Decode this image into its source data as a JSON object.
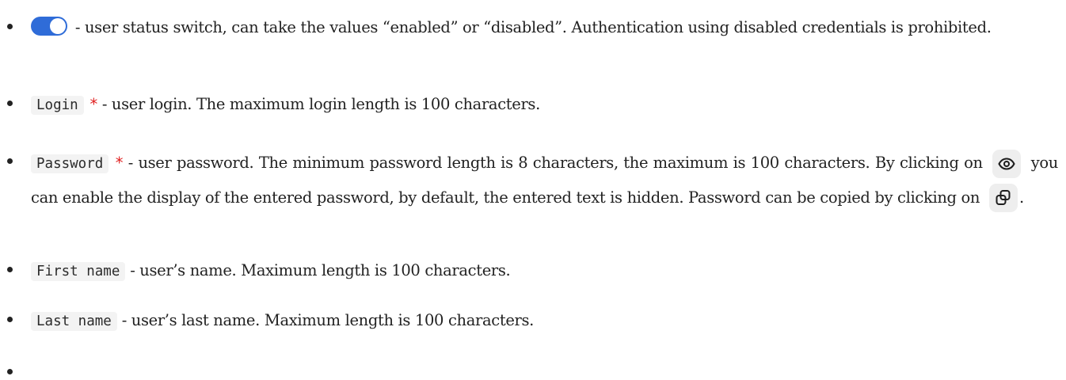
{
  "items": [
    {
      "icon": "toggle-switch-on",
      "description": "- user status switch, can take the values “enabled” or “disabled”. Authentication using disabled credentials is prohibited."
    },
    {
      "field": "Login",
      "required_mark": "*",
      "description": "- user login. The maximum login length is 100 characters."
    },
    {
      "field": "Password",
      "required_mark": "*",
      "description_part1": "- user password. The minimum password length is 8 characters, the maximum is 100 characters. By clicking on",
      "show_icon": "eye-icon",
      "description_part2": "you can enable the display of the entered password, by default, the entered text is hidden. Password can be copied by clicking on",
      "copy_icon": "copy-icon",
      "description_part3": "."
    },
    {
      "field": "First name",
      "description": "- user’s name. Maximum length is 100 characters."
    },
    {
      "field": "Last name",
      "description": "- user’s last name. Maximum length is 100 characters."
    },
    {
      "description": ""
    }
  ],
  "colors": {
    "toggle_on": "#2f6cd8",
    "required": "#e02020",
    "code_bg": "#f3f3f3",
    "icon_button_bg": "#eeeeee"
  }
}
